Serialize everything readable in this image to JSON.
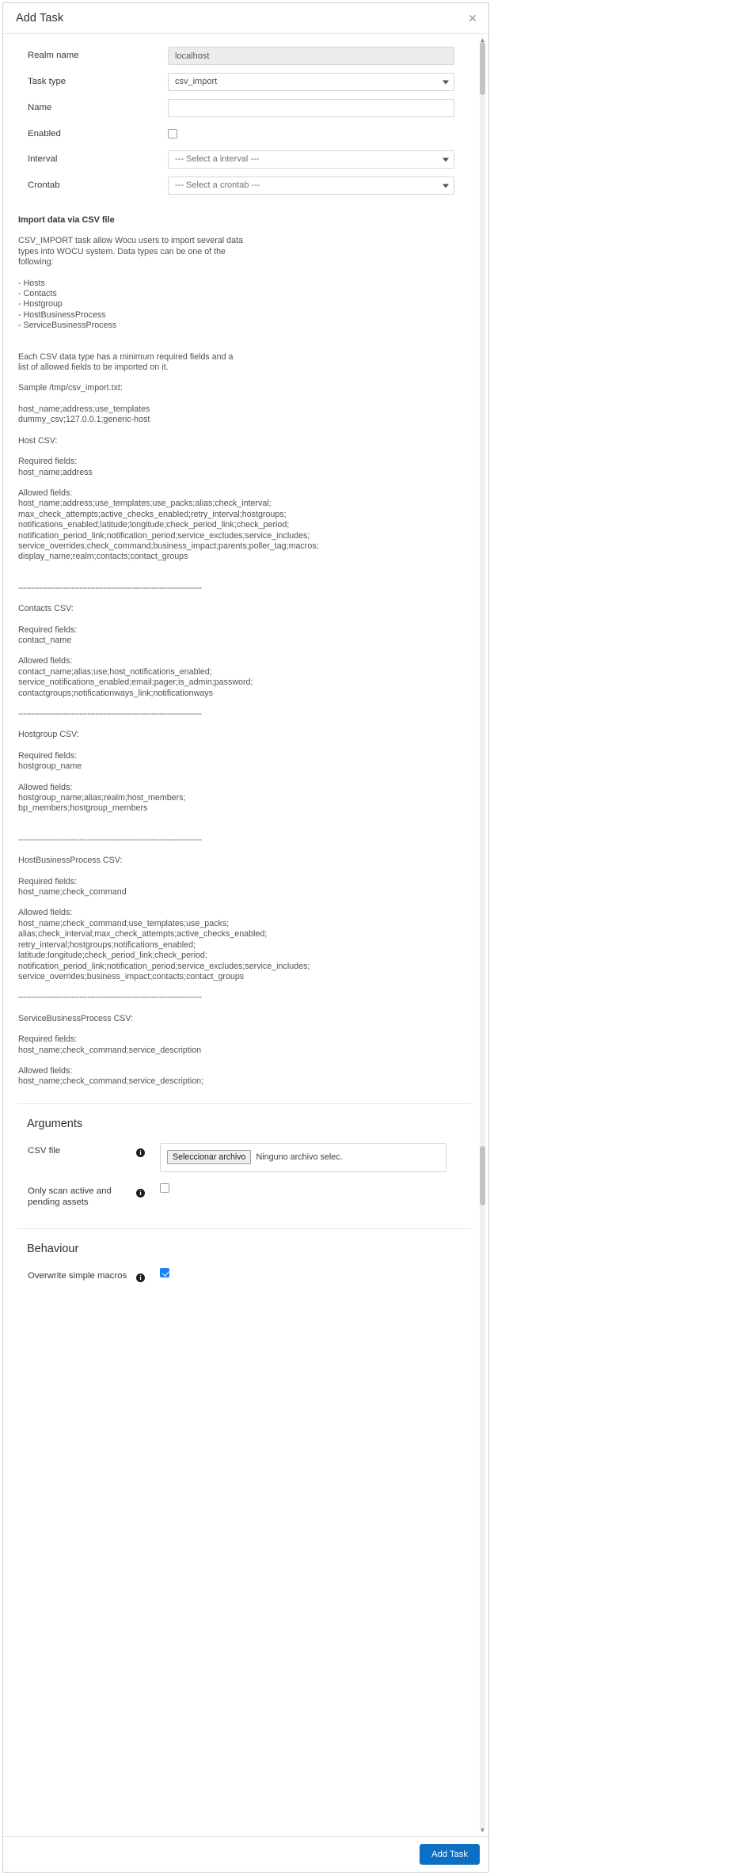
{
  "dialog": {
    "title": "Add Task",
    "close_icon": "close-icon"
  },
  "form": {
    "realm": {
      "label": "Realm name",
      "value": "localhost"
    },
    "task_type": {
      "label": "Task type",
      "value": "csv_import"
    },
    "name": {
      "label": "Name",
      "value": ""
    },
    "enabled": {
      "label": "Enabled",
      "checked": false
    },
    "interval": {
      "label": "Interval",
      "value": "--- Select a interval ---"
    },
    "crontab": {
      "label": "Crontab",
      "value": "--- Select a crontab ---"
    }
  },
  "doc": {
    "heading": "Import data via CSV file",
    "intro": "CSV_IMPORT task allow Wocu users to import several data\ntypes into WOCU system. Data types can be one of the\nfollowing:",
    "types": "- Hosts\n- Contacts\n- Hostgroup\n- HostBusinessProcess\n- ServiceBusinessProcess",
    "fields_note": "Each CSV data type has a minimum required fields and a\nlist of allowed fields to be imported on it.",
    "sample_header": "Sample /tmp/csv_import.txt:",
    "sample_body": "host_name;address;use_templates\ndummy_csv;127.0.0.1;generic-host",
    "rule": "---------------------------------------------------------------------",
    "sections": [
      {
        "title": "Host CSV:",
        "required_label": "Required fields:",
        "required": "host_name;address",
        "allowed_label": "Allowed fields:",
        "allowed": "host_name;address;use_templates;use_packs;alias;check_interval;\nmax_check_attempts;active_checks_enabled;retry_interval;hostgroups;\nnotifications_enabled;latitude;longitude;check_period_link;check_period;\nnotification_period_link;notification_period;service_excludes;service_includes;\nservice_overrides;check_command;business_impact;parents;poller_tag;macros;\ndisplay_name;realm;contacts;contact_groups"
      },
      {
        "title": "Contacts CSV:",
        "required_label": "Required fields:",
        "required": "contact_name",
        "allowed_label": "Allowed fields:",
        "allowed": "contact_name;alias;use;host_notifications_enabled;\nservice_notifications_enabled;email;pager;is_admin;password;\ncontactgroups;notificationways_link;notificationways"
      },
      {
        "title": "Hostgroup CSV:",
        "required_label": "Required fields:",
        "required": "hostgroup_name",
        "allowed_label": "Allowed fields:",
        "allowed": "hostgroup_name;alias;realm;host_members;\nbp_members;hostgroup_members"
      },
      {
        "title": "HostBusinessProcess CSV:",
        "required_label": "Required fields:",
        "required": "host_name;check_command",
        "allowed_label": "Allowed fields:",
        "allowed": "host_name;check_command;use_templates;use_packs;\nalias;check_interval;max_check_attempts;active_checks_enabled;\nretry_interval;hostgroups;notifications_enabled;\nlatitude;longitude;check_period_link;check_period;\nnotification_period_link;notification_period;service_excludes;service_includes;\nservice_overrides;business_impact;contacts;contact_groups"
      },
      {
        "title": "ServiceBusinessProcess CSV:",
        "required_label": "Required fields:",
        "required": "host_name;check_command;service_description",
        "allowed_label": "Allowed fields:",
        "allowed": "host_name;check_command;service_description;"
      }
    ]
  },
  "arguments": {
    "title": "Arguments",
    "csv_file": {
      "label": "CSV file",
      "info_icon": "info-icon",
      "button_label": "Seleccionar archivo",
      "file_status": "Ninguno archivo selec."
    },
    "only_scan": {
      "label": "Only scan active and pending assets",
      "info_icon": "info-icon",
      "checked": false
    }
  },
  "behaviour": {
    "title": "Behaviour",
    "overwrite_macros": {
      "label": "Overwrite simple macros",
      "info_icon": "info-icon",
      "checked": true
    }
  },
  "footer": {
    "submit_label": "Add Task"
  },
  "colors": {
    "primary": "#0b6fc4",
    "checkbox_checked": "#1a83f0",
    "text": "#4d5257"
  }
}
